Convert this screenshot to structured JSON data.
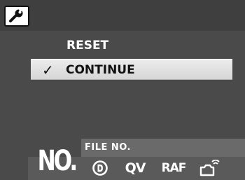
{
  "header": {
    "icon": "wrench-icon"
  },
  "menu": {
    "items": [
      {
        "label": "RESET",
        "selected": false
      },
      {
        "label": "CONTINUE",
        "selected": true
      }
    ],
    "check_mark": "✓"
  },
  "bottom": {
    "section_label": "FILE NO.",
    "big_label": "NO.",
    "icons": [
      {
        "name": "d-circle-icon"
      },
      {
        "label": "QV"
      },
      {
        "label": "RAF"
      },
      {
        "name": "camera-wireless-icon"
      }
    ]
  }
}
